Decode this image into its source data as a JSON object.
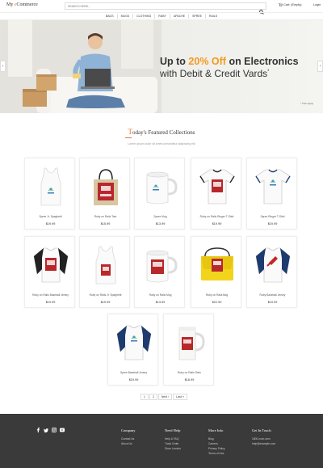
{
  "header": {
    "logo_prefix": "My ",
    "logo_e": "e",
    "logo_suffix": "Commerce",
    "search_placeholder": "SEARCH HERE...",
    "cart_label": "Cart: (Empty)",
    "login_label": "Login"
  },
  "nav": [
    "BAGS",
    "MUGS",
    "CLOTHING",
    "RUBY",
    "APACHE",
    "SPREE",
    "RAILS"
  ],
  "banner": {
    "headline_pre": "Up to ",
    "headline_highlight": "20% Off",
    "headline_post": " on Electronics",
    "sub": "with Debit & Credit Vards",
    "sub_mark": "*",
    "note": "* T&C Apply"
  },
  "featured": {
    "title_initial": "T",
    "title_rest": "oday's Featured Collections",
    "subtitle": "Lorem ipsum dolor sit amet consectetur adipiscing elit"
  },
  "products": [
    {
      "name": "Spree Jr. Spaghetti",
      "price": "$19.99",
      "icon": "tanktop-spree"
    },
    {
      "name": "Ruby on Rails Tote",
      "price": "$15.99",
      "icon": "tote-rails"
    },
    {
      "name": "Spree Mug",
      "price": "$13.99",
      "icon": "mug-spree"
    },
    {
      "name": "Ruby on Rails Ringer T-Shirt",
      "price": "$19.99",
      "icon": "ringer-rails"
    },
    {
      "name": "Spree Ringer T-Shirt",
      "price": "$19.99",
      "icon": "ringer-spree"
    },
    {
      "name": "Ruby on Rails Baseball Jersey",
      "price": "$19.99",
      "icon": "jersey-rails"
    },
    {
      "name": "Ruby on Rails Jr. Spaghetti",
      "price": "$19.99",
      "icon": "tanktop-rails"
    },
    {
      "name": "Ruby on Rails Mug",
      "price": "$13.99",
      "icon": "mug-rails"
    },
    {
      "name": "Ruby on Rails Bag",
      "price": "$22.99",
      "icon": "bag-rails"
    },
    {
      "name": "Ruby Baseball Jersey",
      "price": "$19.99",
      "icon": "jersey-ruby"
    },
    {
      "name": "Spree Baseball Jersey",
      "price": "$19.99",
      "icon": "jersey-spree"
    },
    {
      "name": "Ruby on Rails Stein",
      "price": "$16.99",
      "icon": "stein-rails"
    }
  ],
  "pagination": [
    "1",
    "2",
    "Next ›",
    "Last »"
  ],
  "footer": {
    "social": [
      "facebook-icon",
      "twitter-icon",
      "instagram-icon",
      "youtube-icon"
    ],
    "columns": [
      {
        "title": "Company",
        "links": [
          "Contact Us",
          "About Us"
        ]
      },
      {
        "title": "Need Help",
        "links": [
          "Help & FAQ",
          "Track Order",
          "Store Locator"
        ]
      },
      {
        "title": "More Info",
        "links": [
          "Blog",
          "Careers",
          "Privacy Policy",
          "Terms of Use"
        ]
      },
      {
        "title": "Get In Touch",
        "links": [
          "1800-xxxx-xxxx",
          "help@example.com"
        ]
      }
    ]
  },
  "colors": {
    "accent": "#e8743b",
    "banner_highlight": "#f39a1e",
    "rails_red": "#b8282a",
    "footer_bg": "#3a3a3a"
  }
}
